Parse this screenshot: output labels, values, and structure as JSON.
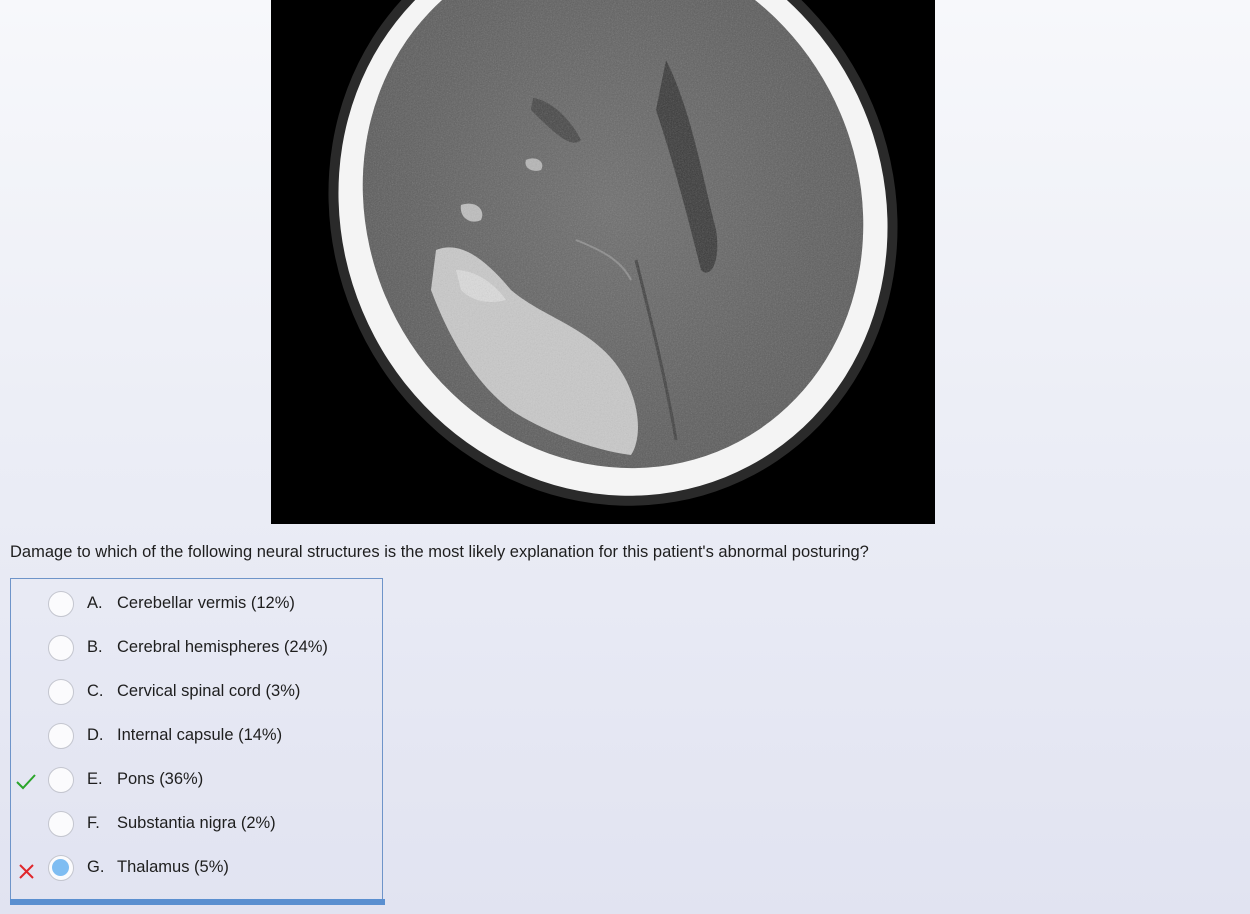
{
  "image": {
    "icon": "head-ct-scan-image"
  },
  "question": {
    "text": "Damage to which of the following neural structures is the most likely explanation for this patient's abnormal posturing?"
  },
  "answers": [
    {
      "letter": "A.",
      "text": "Cerebellar vermis (12%)",
      "mark": "none",
      "selected": false
    },
    {
      "letter": "B.",
      "text": "Cerebral hemispheres (24%)",
      "mark": "none",
      "selected": false
    },
    {
      "letter": "C.",
      "text": "Cervical spinal cord (3%)",
      "mark": "none",
      "selected": false
    },
    {
      "letter": "D.",
      "text": "Internal capsule (14%)",
      "mark": "none",
      "selected": false
    },
    {
      "letter": "E.",
      "text": "Pons (36%)",
      "mark": "correct",
      "selected": false
    },
    {
      "letter": "F.",
      "text": "Substantia nigra (2%)",
      "mark": "none",
      "selected": false
    },
    {
      "letter": "G.",
      "text": "Thalamus (5%)",
      "mark": "incorrect",
      "selected": true
    }
  ],
  "colors": {
    "correct": "#2aa52a",
    "incorrect": "#e0262b",
    "selected_radio": "#7fbdf2",
    "box_border": "#6e94c9"
  }
}
